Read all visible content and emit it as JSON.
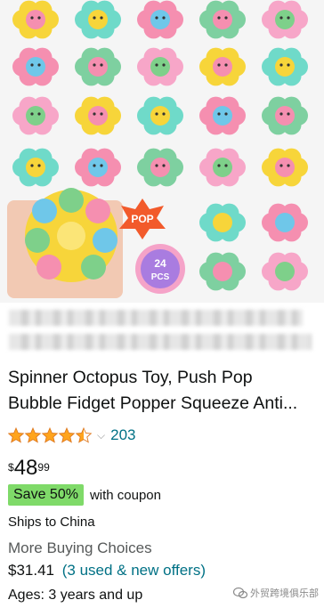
{
  "product": {
    "title_line1": "Spinner Octopus Toy, Push Pop",
    "title_line2": "Bubble Fidget Popper Squeeze Anti...",
    "rating": 4.5,
    "review_count": "203",
    "price_symbol": "$",
    "price_whole": "48",
    "price_fraction": "99",
    "coupon_badge": "Save 50%",
    "coupon_text": "with coupon",
    "shipping": "Ships to China",
    "more_choices_label": "More Buying Choices",
    "offer_price": "$31.41",
    "offer_link": "(3 used & new offers)",
    "ages": "Ages: 3 years and up"
  },
  "image": {
    "badge_pop": "POP",
    "badge_count": "24",
    "badge_unit": "PCS"
  },
  "watermark": {
    "text": "外贸跨境俱乐部"
  },
  "colors": {
    "link": "#007185",
    "coupon_green": "#7fda69",
    "star": "#ffa41c",
    "secondary_text": "#565959"
  }
}
